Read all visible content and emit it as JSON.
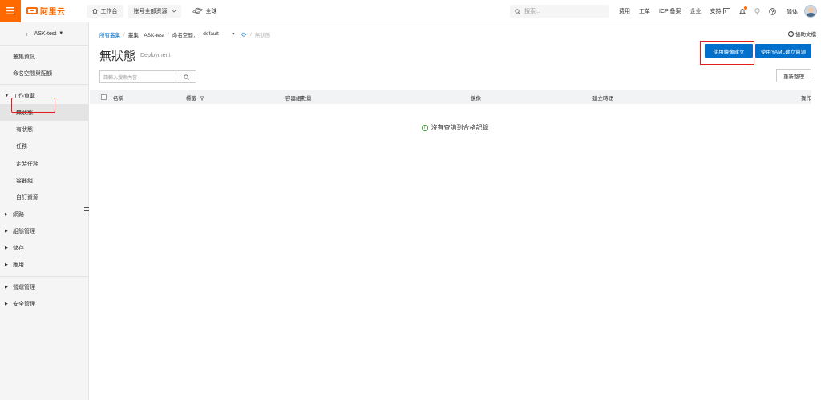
{
  "topbar": {
    "logo": "阿里云",
    "workbench": "工作台",
    "account_scope": "账号全部资源",
    "region": "全球",
    "search_placeholder": "搜索...",
    "links": [
      "费用",
      "工单",
      "ICP 备案",
      "企业",
      "支持"
    ],
    "lang": "简体"
  },
  "sidebar": {
    "cluster": "ASK-test",
    "items": [
      "叢集資訊",
      "命名空間與配額"
    ],
    "workload_group": "工作負載",
    "workload_items": [
      "無狀態",
      "有狀態",
      "任務",
      "定時任務",
      "容器組",
      "自訂資源"
    ],
    "groups": [
      "網路",
      "組態管理",
      "儲存",
      "應用"
    ],
    "groups2": [
      "營運管理",
      "安全管理"
    ]
  },
  "breadcrumb": {
    "all_clusters": "所有叢集",
    "cluster_label": "叢集：ASK-test",
    "namespace_label": "命名空間：",
    "namespace_value": "default",
    "current": "無狀態",
    "help": "協助文檔"
  },
  "page": {
    "title": "無狀態",
    "subtitle": "Deployment",
    "btn_image_create": "使用鏡像建立",
    "btn_yaml_create": "使用YAML建立資源",
    "search_placeholder": "請輸入搜索內容",
    "btn_sort": "重新整理"
  },
  "table": {
    "headers": {
      "name": "名稱",
      "label": "標籤",
      "count": "容器組數量",
      "image": "鏡像",
      "created": "建立時間",
      "ops": "操作"
    },
    "empty": "沒有查詢到合格記錄"
  },
  "colors": {
    "brand": "#ff6a00",
    "primary": "#0070cc",
    "highlight": "#e31d1d"
  }
}
